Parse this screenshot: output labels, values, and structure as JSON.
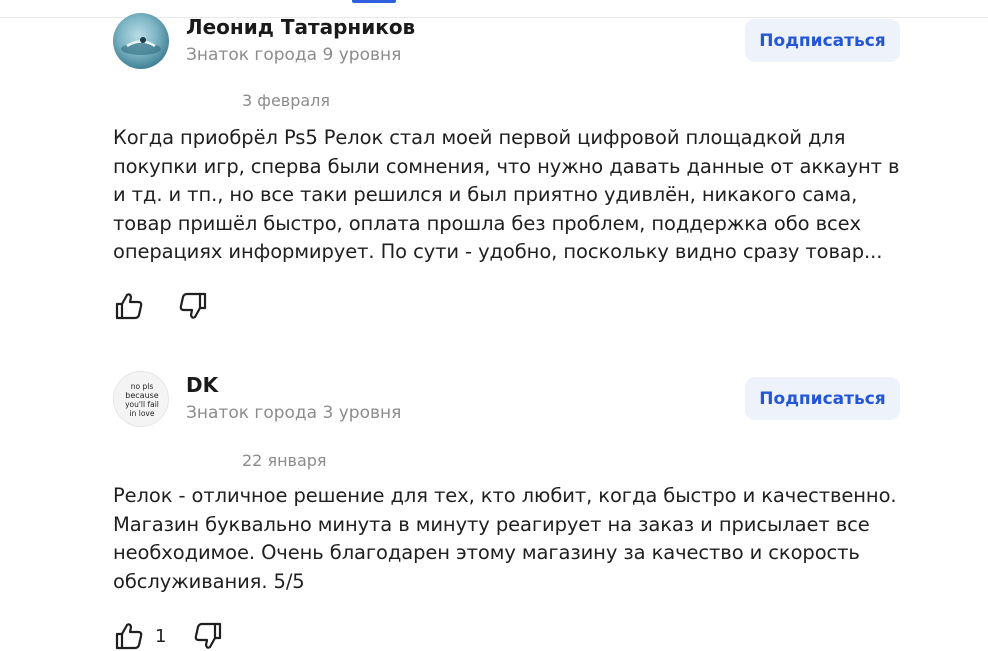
{
  "reviews": [
    {
      "author": "Леонид Татарников",
      "level": "Знаток города 9 уровня",
      "subscribe_label": "Подписаться",
      "date": "3 февраля",
      "text_lines": [
        "Когда приобрёл Ps5 Релок стал моей первой цифровой площадкой для",
        "покупки игр, сперва были сомнения, что нужно давать данные от аккаунт в",
        "и тд. и тп., но все таки решился и был приятно удивлён, никакого сама,",
        "товар пришёл быстро, оплата прошла без проблем, поддержка обо всех",
        "операциях информирует. По сути - удобно, поскольку видно сразу товар..."
      ],
      "likes": ""
    },
    {
      "author": "DK",
      "level": "Знаток города 3 уровня",
      "subscribe_label": "Подписаться",
      "date": "22 января",
      "avatar_text": [
        "no pls",
        "because",
        "you'll fail",
        "in love"
      ],
      "text_lines": [
        "Релок - отличное решение для тех, кто любит, когда быстро и качественно.",
        "Магазин буквально минута в минуту реагирует на заказ и присылает все",
        "необходимое. Очень благодарен этому магазину за качество и скорость",
        "обслуживания. 5/5"
      ],
      "likes": "1"
    }
  ],
  "icons": {
    "like": "thumbs-up-icon",
    "dislike": "thumbs-down-icon"
  },
  "colors": {
    "accent": "#2457d6",
    "button_bg": "#eef2fb",
    "muted_text": "#8c8c8c"
  }
}
